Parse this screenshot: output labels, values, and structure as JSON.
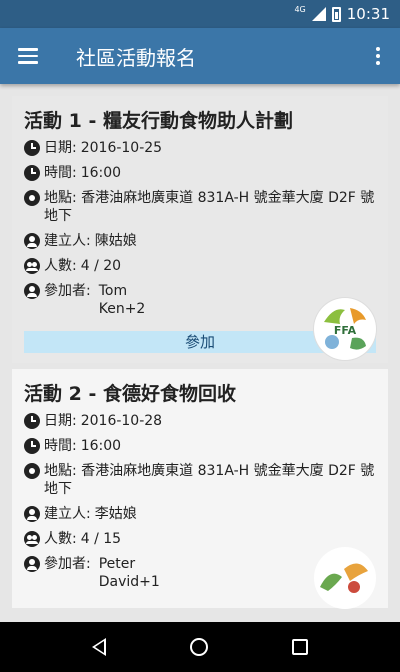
{
  "status_bar": {
    "network": "4G",
    "time": "10:31"
  },
  "app_bar": {
    "title": "社區活動報名"
  },
  "events": [
    {
      "title": "活動 1 - 糧友行動食物助人計劃",
      "date_label": "日期:",
      "date": "2016-10-25",
      "time_label": "時間:",
      "time": "16:00",
      "location_label": "地點:",
      "location": "香港油麻地廣東道 831A-H 號金華大廈 D2F 號地下",
      "creator_label": "建立人:",
      "creator": "陳姑娘",
      "count_label": "人數:",
      "count": "4 / 20",
      "participants_label": "參加者:",
      "participants": "Tom\nKen+2",
      "logo_text": "FFA",
      "join_label": "參加"
    },
    {
      "title": "活動 2 - 食德好食物回收",
      "date_label": "日期:",
      "date": "2016-10-28",
      "time_label": "時間:",
      "time": "16:00",
      "location_label": "地點:",
      "location": "香港油麻地廣東道 831A-H 號金華大廈 D2F 號地下",
      "creator_label": "建立人:",
      "creator": "李姑娘",
      "count_label": "人數:",
      "count": "4 / 15",
      "participants_label": "參加者:",
      "participants": "Peter\nDavid+1"
    }
  ],
  "icons": {
    "menu": "hamburger-icon",
    "more": "more-vert-icon",
    "date": "clock-icon",
    "time": "clock-icon",
    "location": "pin-icon",
    "creator": "person-icon",
    "count": "group-icon",
    "participants": "person-icon"
  },
  "colors": {
    "status_bar": "#2e5e86",
    "app_bar": "#3b76a8",
    "join_button": "#c3e6f7"
  }
}
